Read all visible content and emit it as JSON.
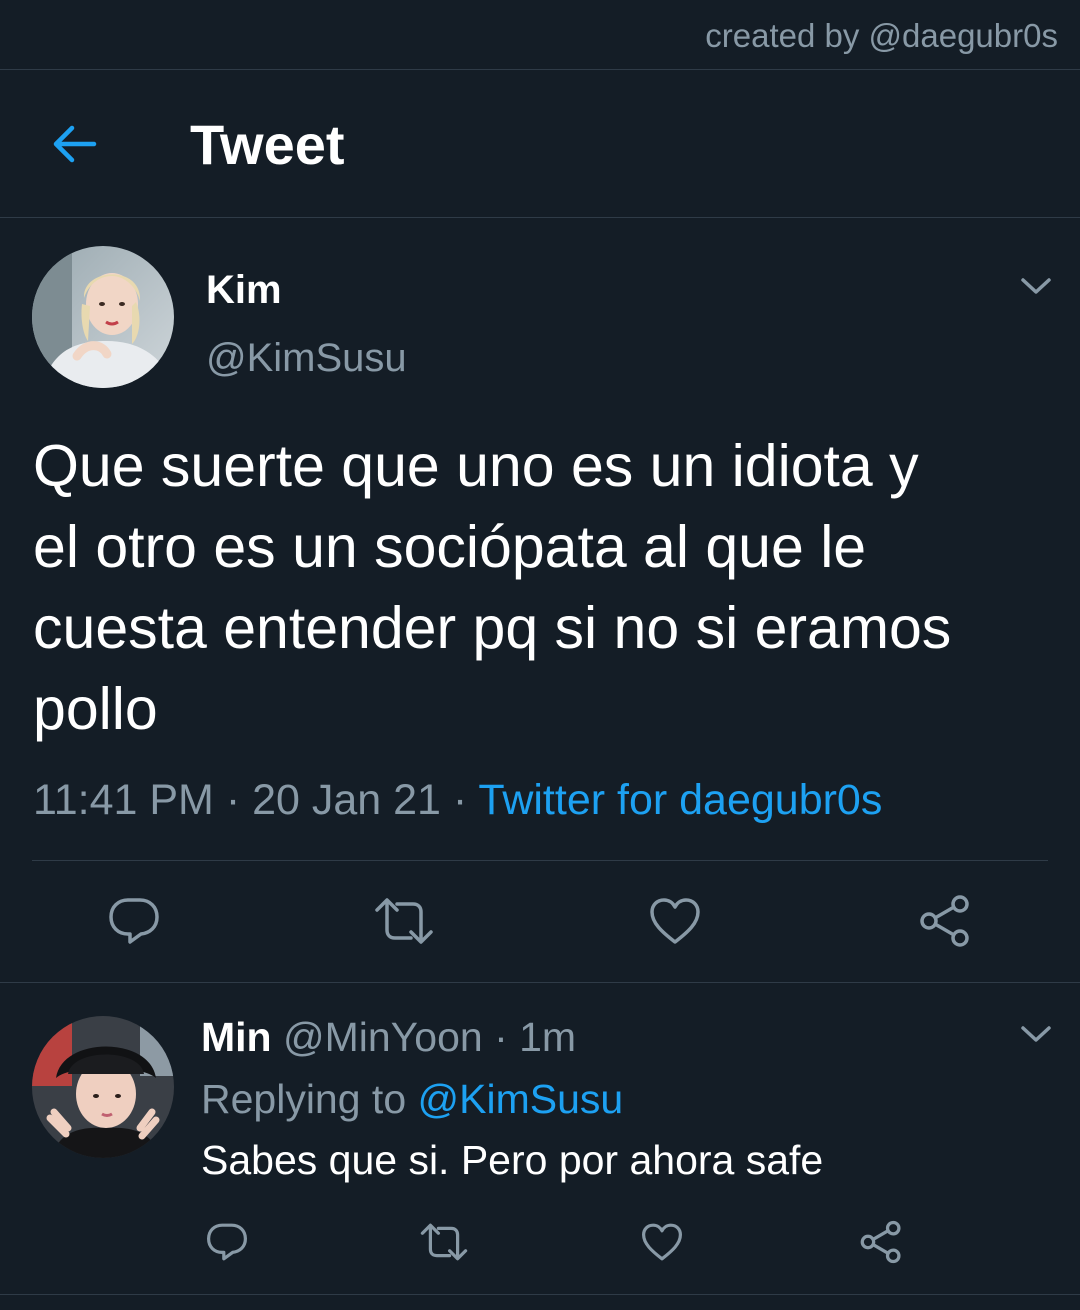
{
  "credit": "created by @daegubr0s",
  "header": {
    "title": "Tweet"
  },
  "tweet": {
    "display_name": "Kim",
    "handle": "@KimSusu",
    "text_lines": [
      "Que suerte que uno es un idiota y",
      "el otro es un sociópata al que le",
      "cuesta entender pq si no si eramos",
      "pollo"
    ],
    "time": "11:41 PM",
    "date": "20 Jan 21",
    "separator": " · ",
    "source": "Twitter for daegubr0s"
  },
  "reply": {
    "display_name": "Min",
    "handle": "@MinYoon",
    "age": "1m",
    "replying_prefix": "Replying to ",
    "replying_to": "@KimSusu",
    "text": "Sabes que si. Pero por ahora safe"
  },
  "colors": {
    "background": "#141d26",
    "accent": "#1da1f2",
    "muted": "#8899a6",
    "divider": "#2f3b47"
  },
  "icons": [
    "back-arrow-icon",
    "chevron-down-icon",
    "reply-icon",
    "retweet-icon",
    "like-icon",
    "share-icon"
  ]
}
